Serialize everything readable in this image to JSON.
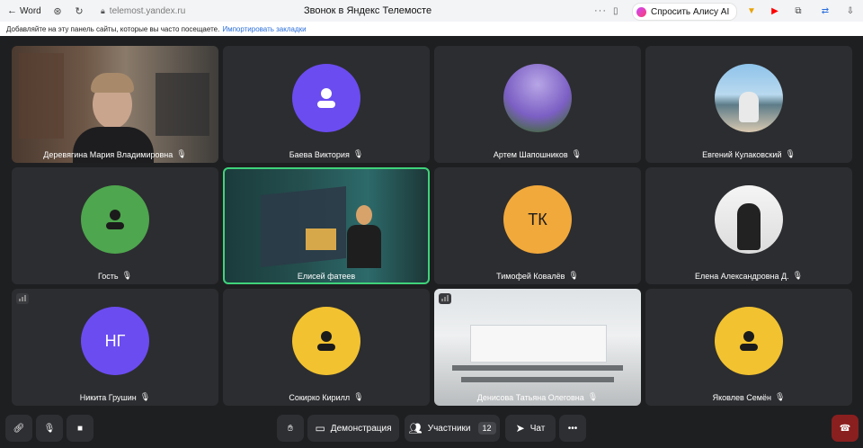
{
  "browser": {
    "back_label": "Word",
    "url_host": "telemost.yandex.ru",
    "page_title": "Звонок в Яндекс Телемосте",
    "alice_label": "Спросить Алису AI",
    "bookmarks_text": "Добавляйте на эту панель сайты, которые вы часто посещаете.",
    "import_link": "Импортировать закладки"
  },
  "participants": [
    {
      "name": "Деревягина Мария Владимировна",
      "kind": "video"
    },
    {
      "name": "Баева Виктория",
      "kind": "icon",
      "color": "#6b4cf0"
    },
    {
      "name": "Артем Шапошников",
      "kind": "photo"
    },
    {
      "name": "Евгений Кулаковский",
      "kind": "photo"
    },
    {
      "name": "Гость",
      "kind": "icon",
      "color": "#4ea64e"
    },
    {
      "name": "Елисей фатеев",
      "kind": "video",
      "active": true
    },
    {
      "name": "Тимофей Ковалёв",
      "kind": "initials",
      "initials": "ТК",
      "color": "#f2a93b"
    },
    {
      "name": "Елена Александровна Д.",
      "kind": "photo"
    },
    {
      "name": "Никита Грушин",
      "kind": "initials",
      "initials": "НГ",
      "color": "#6b4cf0"
    },
    {
      "name": "Сокирко Кирилл",
      "kind": "icon",
      "color": "#f2c230"
    },
    {
      "name": "Денисова Татьяна Олеговна",
      "kind": "video"
    },
    {
      "name": "Яковлев Семён",
      "kind": "icon",
      "color": "#f2c230"
    }
  ],
  "controls": {
    "demo_label": "Демонстрация",
    "participants_label": "Участники",
    "participants_count": "12",
    "chat_label": "Чат"
  }
}
